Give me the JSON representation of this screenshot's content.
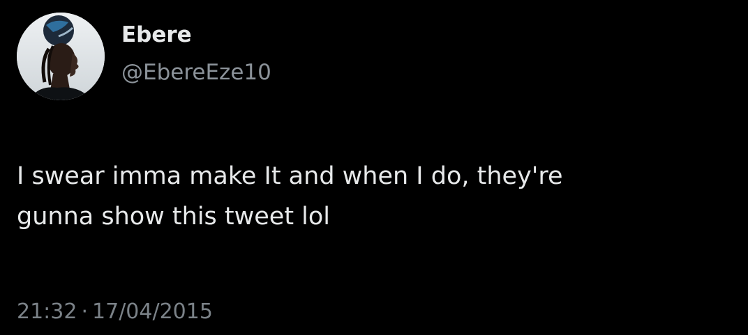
{
  "tweet": {
    "author": {
      "display_name": "Ebere",
      "handle": "@EbereEze10",
      "avatar_icon": "profile-photo-avatar"
    },
    "text": "I swear imma make It and when I do, they're\ngunna show this tweet lol",
    "time": "21:32",
    "separator": "·",
    "date": "17/04/2015"
  },
  "colors": {
    "background": "#000000",
    "primary_text": "#e7e9ea",
    "secondary_text": "#8b9299"
  }
}
